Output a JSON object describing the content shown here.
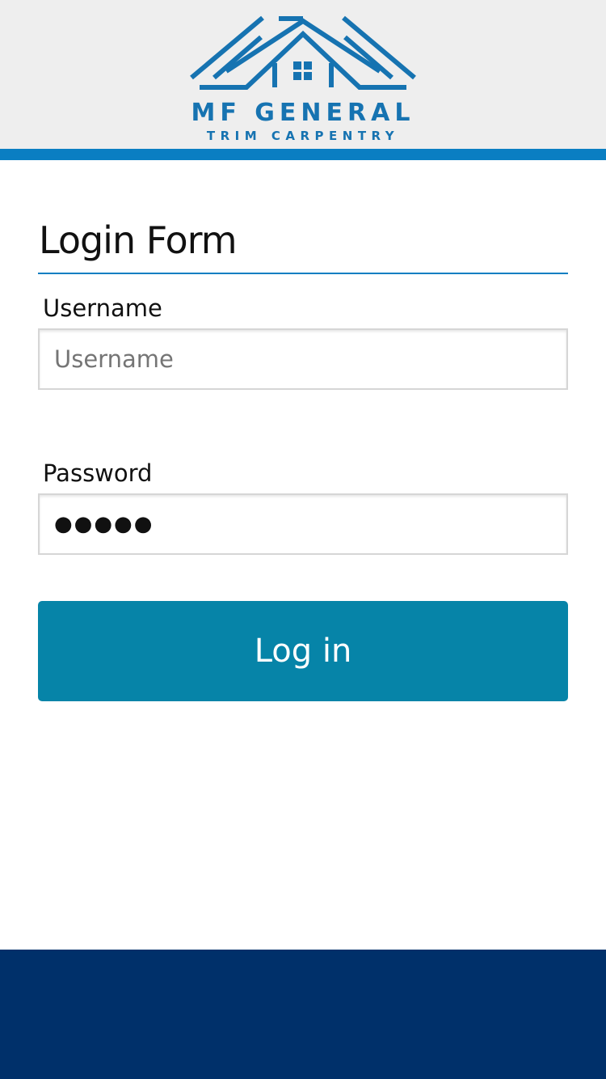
{
  "brand": {
    "name": "MF GENERAL",
    "tagline": "TRIM CARPENTRY",
    "color": "#1673b1"
  },
  "icons": [
    "house-logo-icon"
  ],
  "form": {
    "title": "Login Form",
    "username_label": "Username",
    "username_placeholder": "Username",
    "password_label": "Password",
    "password_value": "●●●●●",
    "login_button": "Log in"
  },
  "colors": {
    "header_bg": "#eeeeee",
    "accent": "#0a7ec2",
    "button": "#0684a8",
    "footer": "#00306a"
  }
}
